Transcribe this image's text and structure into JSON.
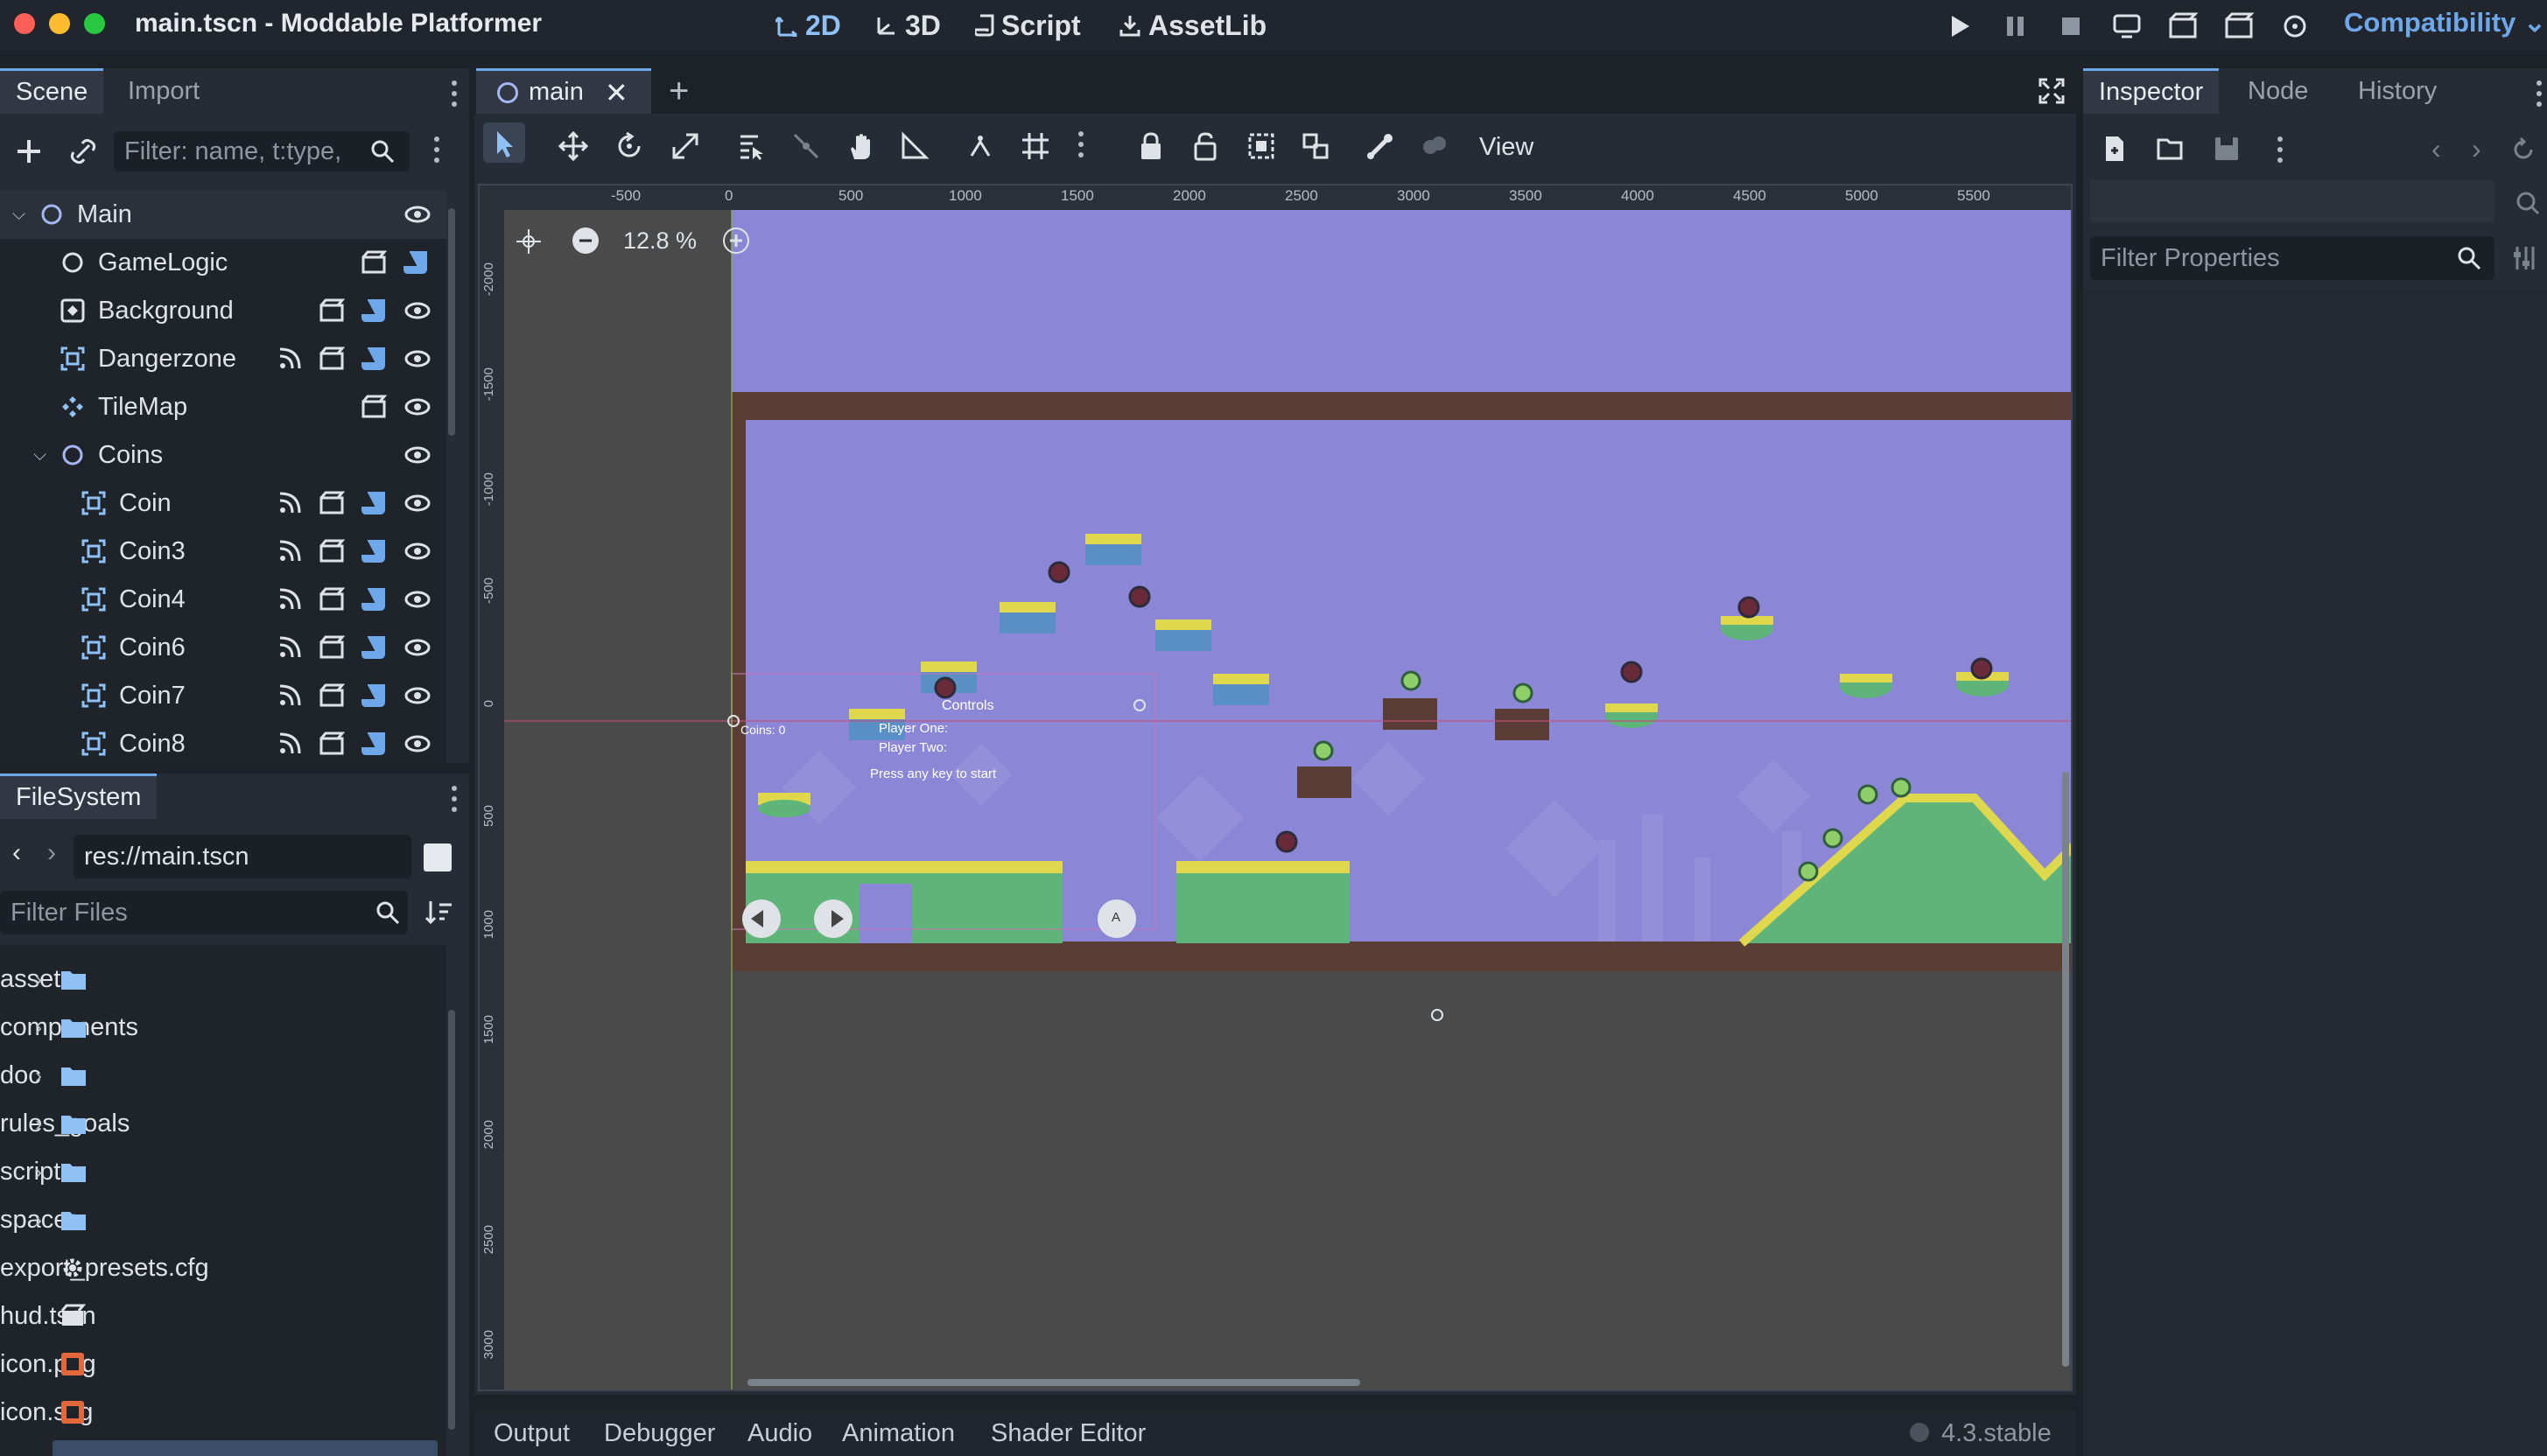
{
  "window": {
    "title": "main.tscn - Moddable Platformer"
  },
  "workspaces": [
    {
      "label": "2D",
      "icon": "2d-icon",
      "active": true
    },
    {
      "label": "3D",
      "icon": "3d-icon",
      "active": false
    },
    {
      "label": "Script",
      "icon": "script-icon",
      "active": false
    },
    {
      "label": "AssetLib",
      "icon": "assetlib-icon",
      "active": false
    }
  ],
  "renderer": {
    "label": "Compatibility"
  },
  "scene_dock": {
    "tabs": [
      "Scene",
      "Import"
    ],
    "filter_placeholder": "Filter: name, t:type,",
    "nodes": [
      {
        "label": "Main",
        "icon": "node-icon"
      },
      {
        "label": "GameLogic",
        "icon": "node-icon"
      },
      {
        "label": "Background",
        "icon": "parallax-icon"
      },
      {
        "label": "Dangerzone",
        "icon": "area-icon"
      },
      {
        "label": "TileMap",
        "icon": "tilemap-icon"
      },
      {
        "label": "Coins",
        "icon": "node-icon"
      },
      {
        "label": "Coin",
        "icon": "area-icon"
      },
      {
        "label": "Coin3",
        "icon": "area-icon"
      },
      {
        "label": "Coin4",
        "icon": "area-icon"
      },
      {
        "label": "Coin6",
        "icon": "area-icon"
      },
      {
        "label": "Coin7",
        "icon": "area-icon"
      },
      {
        "label": "Coin8",
        "icon": "area-icon"
      }
    ]
  },
  "filesystem": {
    "tab": "FileSystem",
    "path": "res://main.tscn",
    "filter_placeholder": "Filter Files",
    "items": [
      {
        "label": "assets",
        "type": "folder"
      },
      {
        "label": "components",
        "type": "folder"
      },
      {
        "label": "doc",
        "type": "folder"
      },
      {
        "label": "rules_goals",
        "type": "folder"
      },
      {
        "label": "scripts",
        "type": "folder"
      },
      {
        "label": "spaces",
        "type": "folder"
      },
      {
        "label": "export_presets.cfg",
        "type": "config"
      },
      {
        "label": "hud.tscn",
        "type": "scene"
      },
      {
        "label": "icon.png",
        "type": "image"
      },
      {
        "label": "icon.svg",
        "type": "image"
      }
    ]
  },
  "editor": {
    "scene_tab": "main",
    "zoom": "12.8 %",
    "view_menu": "View",
    "ruler_top": [
      "-500",
      "0",
      "500",
      "1000",
      "1500",
      "2000",
      "2500",
      "3000",
      "3500",
      "4000",
      "4500",
      "5000",
      "5500"
    ],
    "ruler_left": [
      "-2000",
      "-1500",
      "-1000",
      "-500",
      "0",
      "500",
      "1000",
      "1500",
      "2000",
      "2500",
      "3000"
    ]
  },
  "game": {
    "controls_title": "Controls",
    "player_one": "Player One:",
    "player_two": "Player Two:",
    "press_start": "Press any key to start",
    "coins": "Coins: 0",
    "button_a": "A"
  },
  "inspector": {
    "tabs": [
      "Inspector",
      "Node",
      "History"
    ],
    "filter_placeholder": "Filter Properties"
  },
  "bottom_panel": {
    "tabs": [
      "Output",
      "Debugger",
      "Audio",
      "Animation",
      "Shader Editor"
    ],
    "version": "4.3.stable"
  },
  "colors": {
    "accent": "#6ea8ea",
    "sky": "#8c86d6",
    "grass": "#5fb47a",
    "dirt": "#5a3e35",
    "grass_top": "#e0d84c"
  }
}
